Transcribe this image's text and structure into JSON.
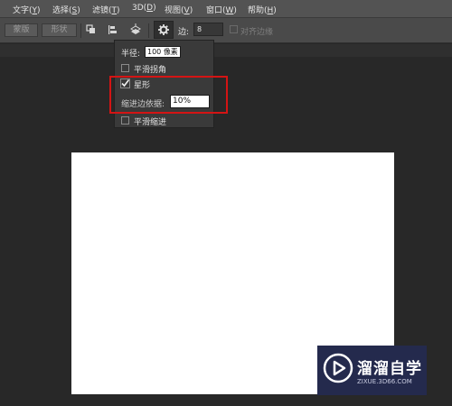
{
  "menubar": {
    "items": [
      {
        "label": "文字(",
        "key": "Y",
        "tail": ")"
      },
      {
        "label": "选择(",
        "key": "S",
        "tail": ")"
      },
      {
        "label": "滤镜(",
        "key": "T",
        "tail": ")"
      },
      {
        "label": "3D(",
        "key": "D",
        "tail": ")"
      },
      {
        "label": "视图(",
        "key": "V",
        "tail": ")"
      },
      {
        "label": "窗口(",
        "key": "W",
        "tail": ")"
      },
      {
        "label": "帮助(",
        "key": "H",
        "tail": ")"
      }
    ]
  },
  "options": {
    "mask_button": "蒙版",
    "shape_button": "形状",
    "edges_label": "边:",
    "edges_value": "8",
    "align_edges_label": "对齐边缘"
  },
  "popup": {
    "radius_label": "半径:",
    "radius_value": "100 像素",
    "smooth_corners_label": "平滑拐角",
    "smooth_corners_checked": false,
    "star_label": "星形",
    "star_checked": true,
    "indent_label": "缩进边依据:",
    "indent_value": "10%",
    "smooth_indents_label": "平滑缩进",
    "smooth_indents_checked": false
  },
  "watermark": {
    "title": "溜溜自学",
    "subtitle": "ZIXUE.3D66.COM"
  },
  "colors": {
    "highlight_box": "#d41414",
    "watermark_bg": "#242a4d"
  }
}
